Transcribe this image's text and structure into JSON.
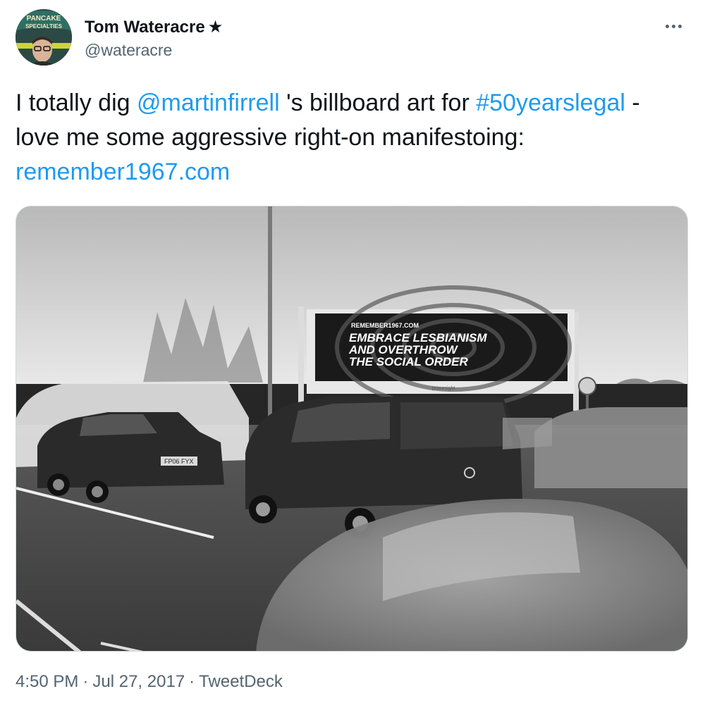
{
  "author": {
    "name": "Tom Wateracre",
    "star": "★",
    "handle": "@wateracre",
    "avatar_sign_line1": "PANCAKE",
    "avatar_sign_line2": "SPECIALTIES"
  },
  "tweet": {
    "text_part1": "I totally dig ",
    "mention": "@martinfirrell",
    "text_part2": " 's billboard art for ",
    "hashtag": "#50yearslegal",
    "text_part3": " - love me some aggressive right-on manifestoing: ",
    "link": "remember1967.com"
  },
  "media": {
    "billboard_url": "REMEMBER1967.COM",
    "billboard_line1": "EMBRACE LESBIANISM",
    "billboard_line2": "AND OVERTHROW",
    "billboard_line3": "THE SOCIAL ORDER",
    "billboard_brand": "primesight",
    "plate_mazda": "FP06 FYX"
  },
  "footer": {
    "time": "4:50 PM",
    "date": "Jul 27, 2017",
    "source": "TweetDeck",
    "separator": "·"
  },
  "colors": {
    "link": "#1d9bf0",
    "secondary_text": "#536471",
    "primary_text": "#0f1419"
  },
  "icons": {
    "more": "more-horizontal-icon"
  }
}
